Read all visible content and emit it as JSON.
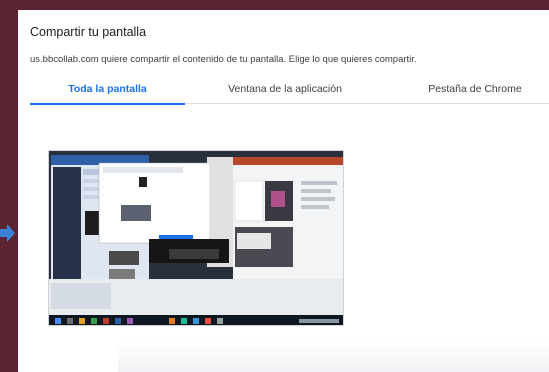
{
  "dialog": {
    "title": "Compartir tu pantalla",
    "subtitle": "us.bbcollab.com quiere compartir el contenido de tu pantalla. Elige lo que quieres compartir."
  },
  "tabs": [
    {
      "label": "Toda la pantalla",
      "active": true
    },
    {
      "label": "Ventana de la aplicación",
      "active": false
    },
    {
      "label": "Pestaña de Chrome",
      "active": false
    }
  ],
  "colors": {
    "background": "#5c2331",
    "accent": "#1a73e8",
    "arrow": "#3b82d6"
  },
  "icons": {
    "pointer": "arrow-right-icon"
  }
}
